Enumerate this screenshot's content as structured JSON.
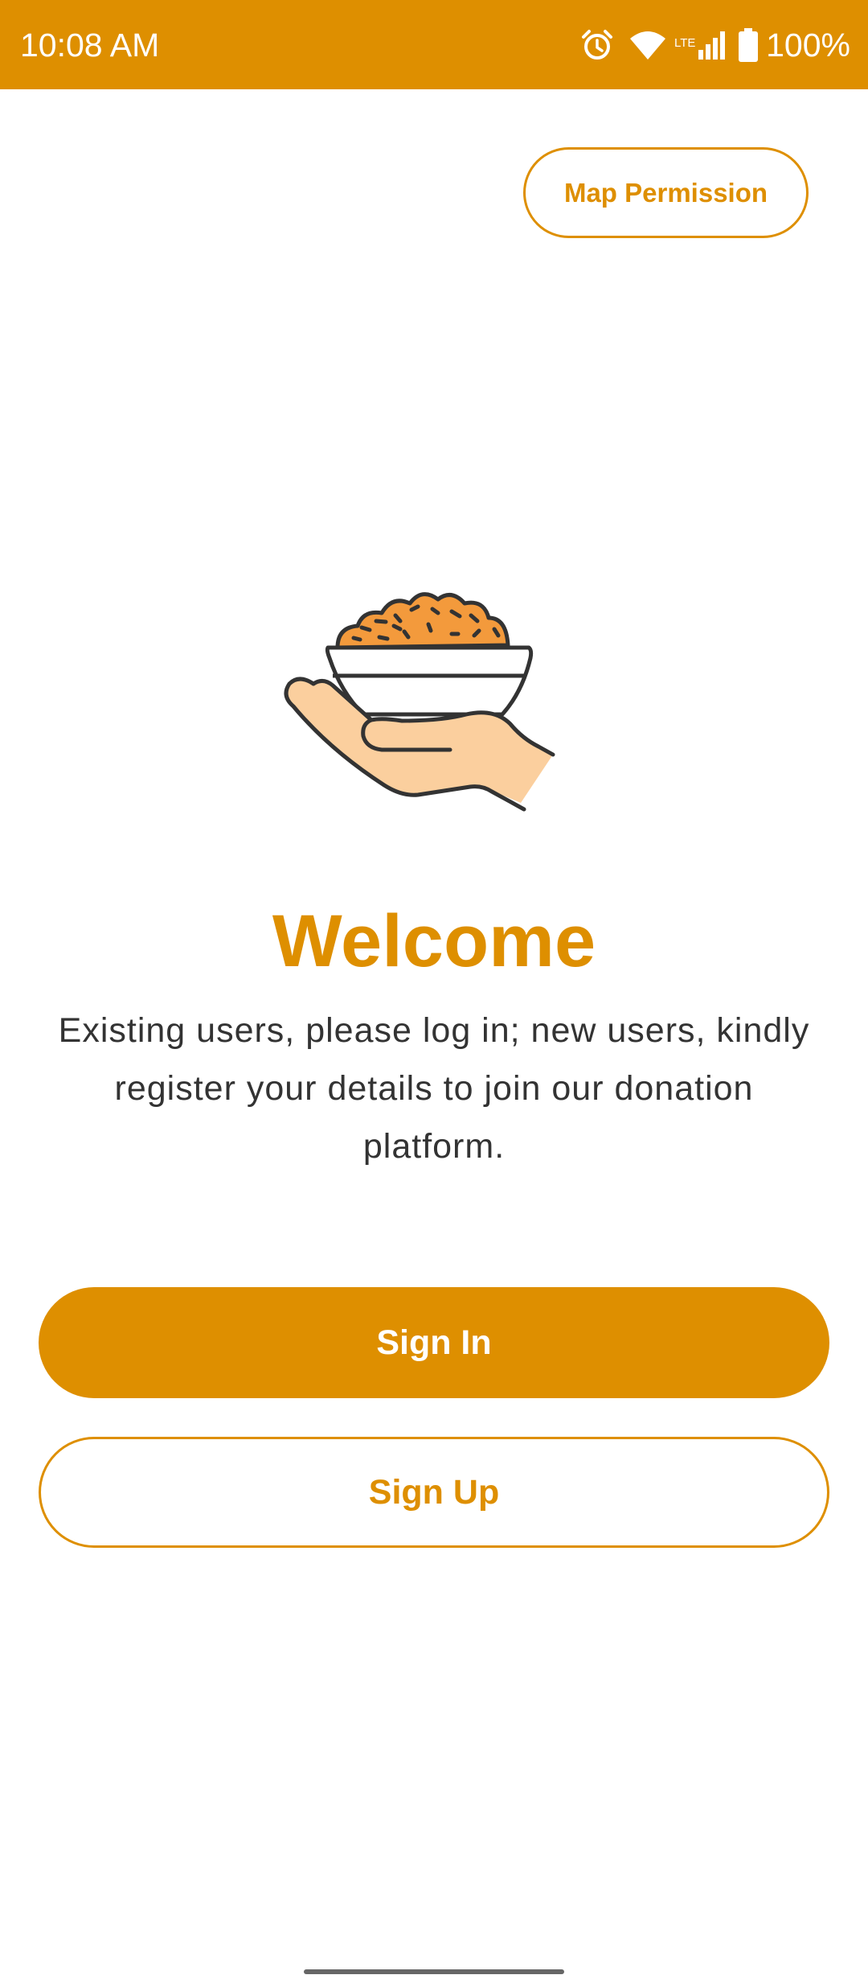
{
  "status_bar": {
    "time": "10:08 AM",
    "battery": "100%",
    "network": "LTE",
    "background_color": "#DE8F00",
    "icons": [
      "alarm-icon",
      "wifi-icon",
      "lte-signal-icon",
      "battery-icon"
    ]
  },
  "header": {
    "map_permission_label": "Map Permission"
  },
  "illustration": {
    "icon": "hand-holding-food-bowl-icon"
  },
  "welcome": {
    "title": "Welcome",
    "message": "Existing users, please log in; new users, kindly register your details to join our donation platform."
  },
  "actions": {
    "sign_in_label": "Sign In",
    "sign_up_label": "Sign Up"
  },
  "theme": {
    "accent": "#DE8F00",
    "text": "#333333",
    "food_fill": "#F39A3C",
    "hand_fill": "#FBCF9E"
  }
}
